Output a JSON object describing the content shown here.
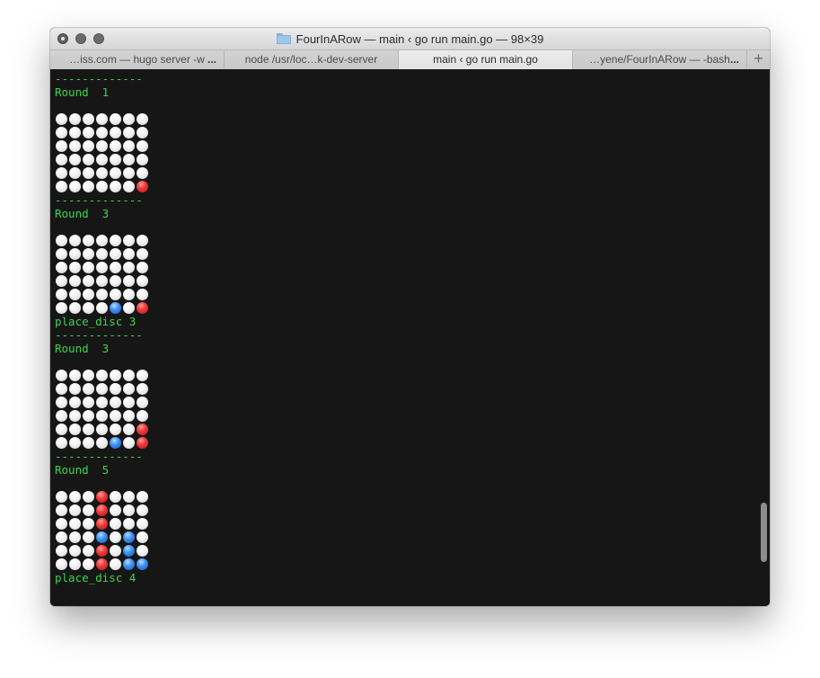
{
  "window": {
    "title": "FourInARow — main ‹ go run main.go — 98×39",
    "folder_icon": "folder-icon"
  },
  "tabs": [
    {
      "label": "…iss.com — hugo server -w",
      "has_more": true,
      "active": false
    },
    {
      "label": "node /usr/loc…k-dev-server",
      "has_more": false,
      "active": false
    },
    {
      "label": "main ‹ go run main.go",
      "has_more": false,
      "active": true
    },
    {
      "label": "…yene/FourInARow — -bash",
      "has_more": true,
      "active": false
    }
  ],
  "tab_more_label": "...",
  "new_tab_label": "+",
  "colors": {
    "terminal_bg": "#161616",
    "text_green": "#3bd64a",
    "disc_red": "#f13b3b",
    "disc_blue": "#3f93f5",
    "disc_empty": "#f2f2f2"
  },
  "terminal": {
    "blocks": [
      {
        "separator": "-------------",
        "round": "Round  1",
        "board": [
          ".......",
          ".......",
          ".......",
          ".......",
          ".......",
          "......R"
        ],
        "after": ""
      },
      {
        "separator": "-------------",
        "round": "Round  3",
        "board": [
          ".......",
          ".......",
          ".......",
          ".......",
          ".......",
          "....B.R"
        ],
        "after": "place_disc 3"
      },
      {
        "separator": "-------------",
        "round": "Round  3",
        "board": [
          ".......",
          ".......",
          ".......",
          ".......",
          "......R",
          "....B.R"
        ],
        "after": ""
      },
      {
        "separator": "-------------",
        "round": "Round  5",
        "board": [
          "...R...",
          "...R...",
          "...R...",
          "...B.B.",
          "...R.B.",
          "...R.BB"
        ],
        "after": "place_disc 4"
      }
    ]
  }
}
